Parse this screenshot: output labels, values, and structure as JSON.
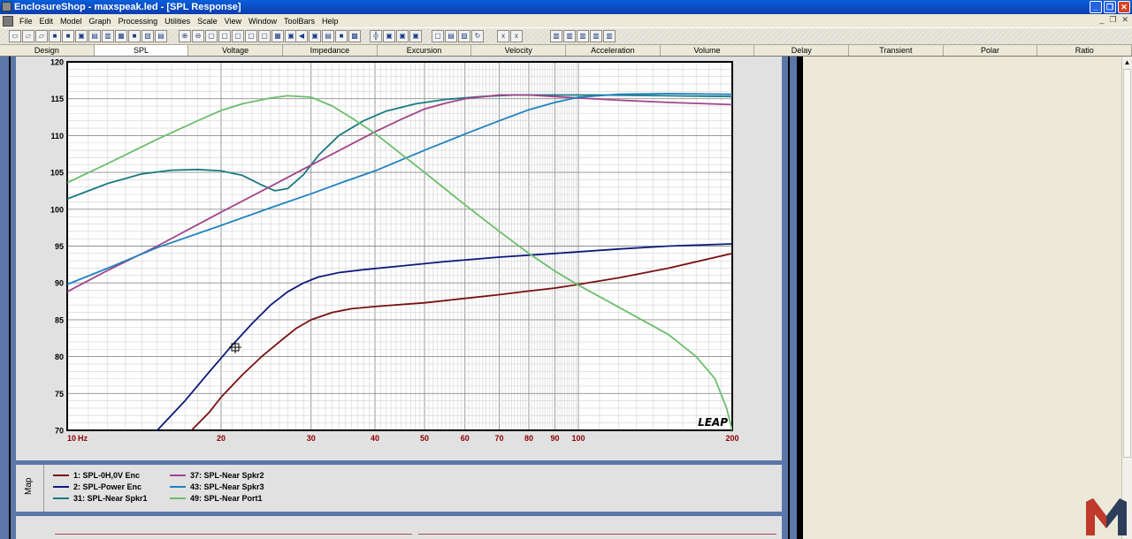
{
  "window": {
    "title": "EnclosureShop - maxspeak.led - [SPL Response]",
    "controls": [
      "_",
      "❐",
      "✕"
    ]
  },
  "menu": {
    "items": [
      "File",
      "Edit",
      "Model",
      "Graph",
      "Processing",
      "Utilities",
      "Scale",
      "View",
      "Window",
      "ToolBars",
      "Help"
    ],
    "mdi_controls": [
      "_",
      "❐",
      "✕"
    ]
  },
  "tabs": {
    "items": [
      "Design",
      "SPL",
      "Voltage",
      "Impedance",
      "Excursion",
      "Velocity",
      "Acceleration",
      "Volume",
      "Delay",
      "Transient",
      "Polar",
      "Ratio"
    ],
    "active": "SPL"
  },
  "map": {
    "label": "Map"
  },
  "watermark": "LEAP",
  "colors": {
    "plot_frame": "#5A77A8",
    "plot_bg": "#FFFFFF",
    "grid": "#A9A9A9",
    "axis_text": "#000000",
    "x_tick_text": "#8B0000"
  },
  "chart_data": {
    "type": "line",
    "title": "",
    "xlabel": "Hz",
    "ylabel": "",
    "x_scale": "log",
    "xlim": [
      10,
      200
    ],
    "ylim": [
      70,
      120
    ],
    "x_ticks": [
      10,
      20,
      30,
      40,
      50,
      60,
      70,
      80,
      90,
      100,
      200
    ],
    "y_ticks": [
      70,
      75,
      80,
      85,
      90,
      95,
      100,
      105,
      110,
      115,
      120
    ],
    "grid": true,
    "legend_position": "bottom",
    "series": [
      {
        "name": "1: SPL-0H,0V Enc",
        "color": "#7A1010",
        "x": [
          17.5,
          19,
          20,
          22,
          24,
          26,
          28,
          30,
          33,
          36,
          40,
          50,
          60,
          70,
          80,
          90,
          100,
          120,
          150,
          200
        ],
        "y": [
          70,
          72.5,
          74.5,
          77.5,
          80,
          82,
          83.8,
          85,
          86,
          86.5,
          86.8,
          87.3,
          87.9,
          88.4,
          88.9,
          89.3,
          89.8,
          90.7,
          92,
          94
        ]
      },
      {
        "name": "2: SPL-Power Enc",
        "color": "#0D1A7A",
        "x": [
          15,
          17,
          19,
          21,
          23,
          25,
          27,
          29,
          31,
          34,
          38,
          45,
          55,
          70,
          90,
          120,
          150,
          200
        ],
        "y": [
          70,
          74,
          78,
          81.5,
          84.5,
          87,
          88.8,
          90,
          90.8,
          91.4,
          91.8,
          92.3,
          92.9,
          93.5,
          94,
          94.6,
          95,
          95.3
        ]
      },
      {
        "name": "31: SPL-Near Spkr1",
        "color": "#1A7A82",
        "x": [
          10,
          12,
          14,
          16,
          18,
          20,
          22,
          24,
          25.5,
          27,
          29,
          31,
          34,
          38,
          42,
          48,
          55,
          65,
          75,
          90,
          110,
          150,
          200
        ],
        "y": [
          101.4,
          103.5,
          104.8,
          105.3,
          105.4,
          105.2,
          104.6,
          103.3,
          102.5,
          102.8,
          104.7,
          107.3,
          110,
          112,
          113.3,
          114.3,
          114.9,
          115.3,
          115.5,
          115.5,
          115.5,
          115.4,
          115.3
        ]
      },
      {
        "name": "37: SPL-Near Spkr2",
        "color": "#A0448A",
        "x": [
          10,
          12,
          15,
          20,
          25,
          30,
          35,
          40,
          45,
          50,
          55,
          60,
          70,
          80,
          100,
          120,
          150,
          200
        ],
        "y": [
          88.8,
          91.7,
          95,
          99.6,
          103.1,
          106,
          108.4,
          110.5,
          112.2,
          113.6,
          114.4,
          115,
          115.5,
          115.5,
          115.1,
          114.8,
          114.5,
          114.2
        ]
      },
      {
        "name": "43: SPL-Near Spkr3",
        "color": "#1E82C0",
        "x": [
          10,
          12,
          15,
          20,
          25,
          30,
          35,
          40,
          50,
          60,
          70,
          80,
          90,
          100,
          120,
          150,
          200
        ],
        "y": [
          89.8,
          92,
          94.8,
          97.8,
          100.2,
          102.1,
          103.8,
          105.2,
          108,
          110.2,
          112,
          113.5,
          114.5,
          115.2,
          115.6,
          115.7,
          115.6
        ]
      },
      {
        "name": "49: SPL-Near Port1",
        "color": "#6CBE6C",
        "x": [
          10,
          12,
          15,
          18,
          20,
          22,
          25,
          27,
          30,
          33,
          36,
          40,
          45,
          50,
          60,
          70,
          80,
          90,
          100,
          120,
          150,
          170,
          185,
          195,
          200
        ],
        "y": [
          103.6,
          106.2,
          109.5,
          112,
          113.4,
          114.3,
          115.1,
          115.4,
          115.2,
          114,
          112.4,
          110.3,
          107.5,
          105,
          100.6,
          97,
          94,
          91.6,
          89.7,
          86.7,
          83,
          80,
          77,
          73,
          70
        ]
      }
    ]
  }
}
